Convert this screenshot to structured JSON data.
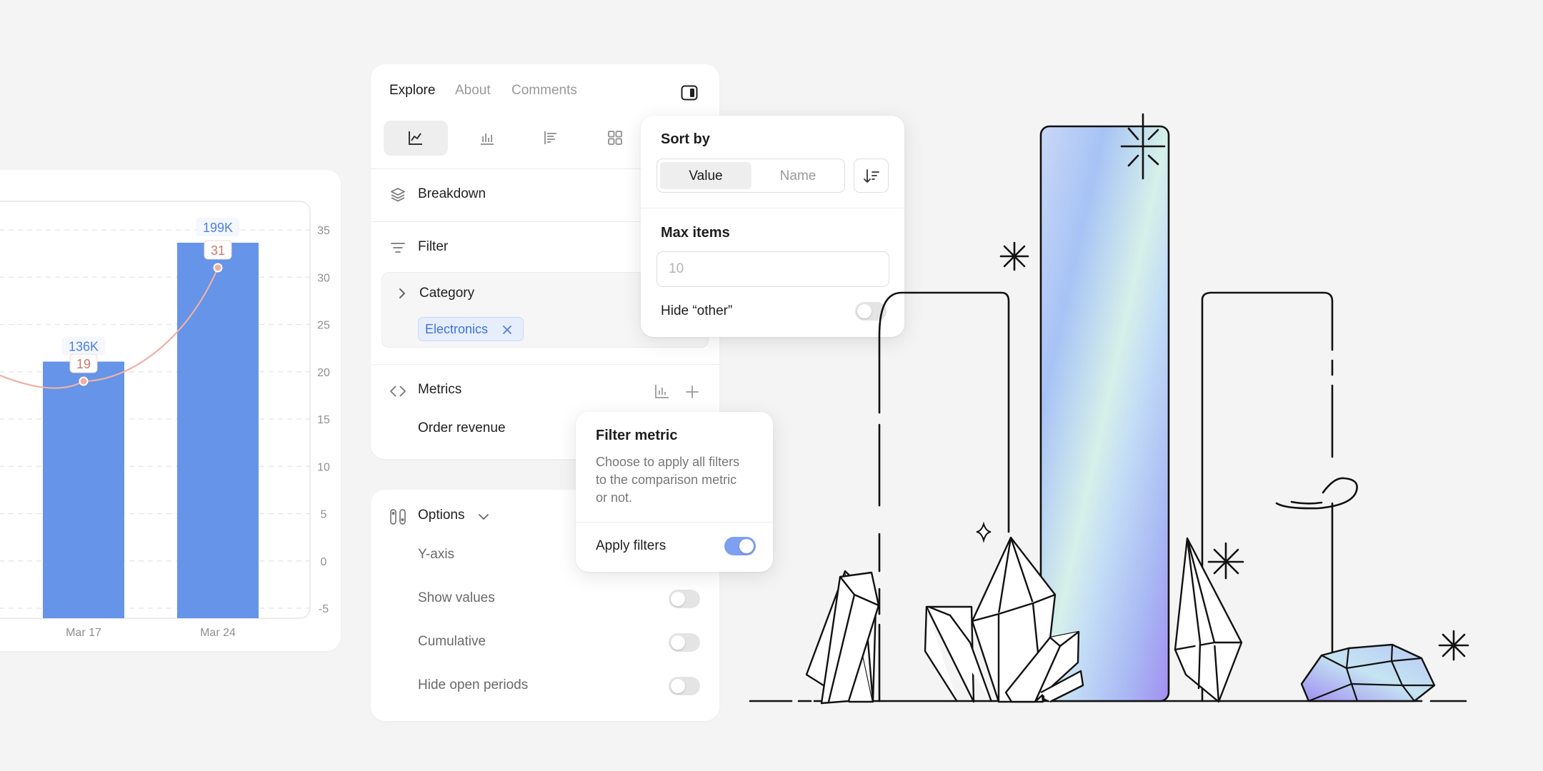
{
  "chart_data": {
    "type": "bar",
    "categories": [
      "Mar 17",
      "Mar 24"
    ],
    "series": [
      {
        "values": [
          136,
          199
        ],
        "value_labels": [
          "136K",
          "199K"
        ]
      },
      {
        "values": [
          19,
          31
        ]
      }
    ],
    "y_right_ticks": [
      "35",
      "30",
      "25",
      "20",
      "15",
      "10",
      "5",
      "0",
      "-5"
    ],
    "ylim_right": [
      -5,
      35
    ],
    "grid": true,
    "colors": {
      "bar": "#6594e8",
      "line": "#eeb0a4"
    }
  },
  "panel": {
    "tabs": [
      "Explore",
      "About",
      "Comments"
    ],
    "active_tab": "Explore",
    "breakdown_label": "Breakdown",
    "filter_label": "Filter",
    "category_label": "Category",
    "chip_label": "Electronics",
    "metrics_label": "Metrics",
    "metric_item": "Order revenue"
  },
  "sort": {
    "title": "Sort by",
    "options": [
      "Value",
      "Name"
    ],
    "selected": "Value",
    "max_items_label": "Max items",
    "max_items_placeholder": "10",
    "hide_other_label": "Hide “other”",
    "hide_other": false
  },
  "filter_metric": {
    "title": "Filter metric",
    "description_lines": [
      "Choose to apply all filters",
      "to the comparison metric",
      "or not."
    ],
    "apply_label": "Apply filters",
    "apply_filters": true
  },
  "options": {
    "title": "Options",
    "items": [
      {
        "label": "Y-axis"
      },
      {
        "label": "Show values",
        "on": false
      },
      {
        "label": "Cumulative",
        "on": false
      },
      {
        "label": "Hide open periods",
        "on": false
      }
    ]
  },
  "colors": {
    "accent": "#6594e8",
    "chip_bg": "#e7efff",
    "chip_text": "#4274d8",
    "toggle_on": "#7f9ff0"
  }
}
